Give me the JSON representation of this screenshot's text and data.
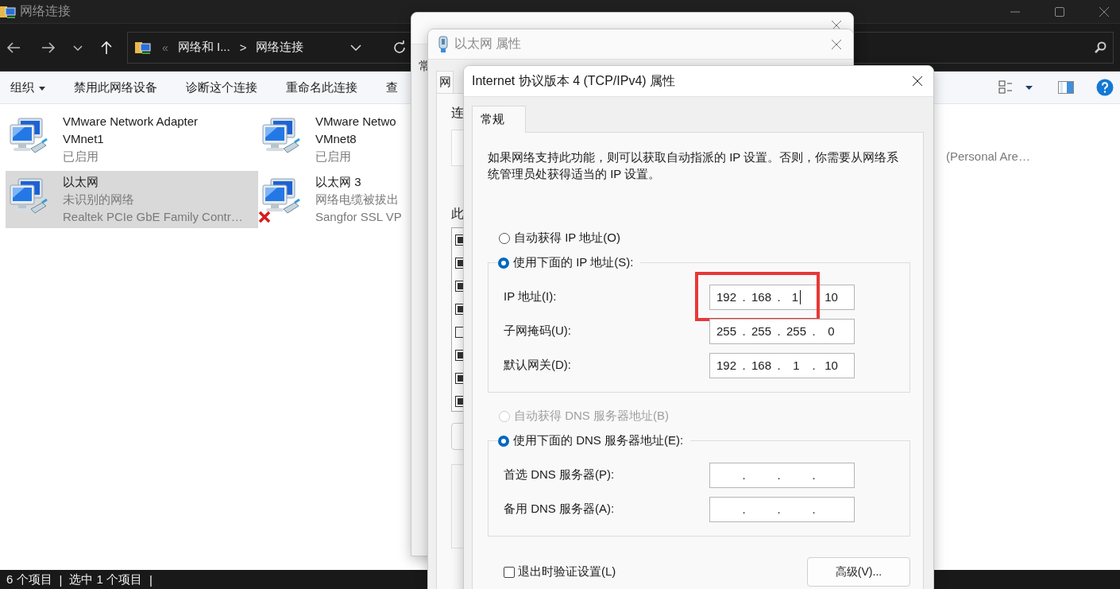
{
  "explorer": {
    "title": "网络连接",
    "breadcrumb": {
      "overflow_mark": "«",
      "parts": [
        "网络和 I...",
        "网络连接"
      ],
      "separator": ">"
    },
    "toolbar": [
      {
        "label": "组织",
        "dropdown": true
      },
      {
        "label": "禁用此网络设备",
        "dropdown": false
      },
      {
        "label": "诊断这个连接",
        "dropdown": false
      },
      {
        "label": "重命名此连接",
        "dropdown": false
      },
      {
        "label": "查",
        "dropdown": false
      }
    ],
    "items": [
      {
        "kind": "adapter",
        "title_lines": [
          "VMware Network Adapter",
          "VMnet1"
        ],
        "detail_lines": [
          "已启用"
        ],
        "selected": false,
        "disconnected": false
      },
      {
        "kind": "adapter",
        "title_lines": [
          "VMware Netwo",
          "VMnet8"
        ],
        "detail_lines": [
          "已启用"
        ],
        "selected": false,
        "disconnected": false
      },
      {
        "kind": "covered",
        "detail_lines": [
          "(Personal Are…"
        ],
        "selected": false
      },
      {
        "kind": "adapter",
        "title_lines": [
          "以太网"
        ],
        "detail_lines": [
          "未识别的网络",
          "Realtek PCIe GbE Family Contr…"
        ],
        "selected": true,
        "disconnected": false
      },
      {
        "kind": "adapter",
        "title_lines": [
          "以太网 3"
        ],
        "detail_lines": [
          "网络电缆被拔出",
          "Sangfor SSL VP"
        ],
        "selected": false,
        "disconnected": true
      }
    ],
    "status_bar": [
      "6 个项目",
      "|",
      "选中 1 个项目",
      "|"
    ]
  },
  "status_dialog": {
    "tab": "常"
  },
  "properties_dialog": {
    "title": "以太网 属性",
    "tab": "网",
    "labels": [
      "连",
      "此"
    ],
    "components": [
      {
        "checked": true
      },
      {
        "checked": true
      },
      {
        "checked": true
      },
      {
        "checked": true
      },
      {
        "checked": false
      },
      {
        "checked": true
      },
      {
        "checked": true
      },
      {
        "checked": true
      }
    ]
  },
  "ipv4_dialog": {
    "title": "Internet 协议版本 4 (TCP/IPv4) 属性",
    "tabs": [
      {
        "label": "常规",
        "selected": true
      }
    ],
    "description": "如果网络支持此功能，则可以获取自动指派的 IP 设置。否则，你需要从网络系统管理员处获得适当的 IP 设置。",
    "sections": [
      {
        "auto_option": {
          "label": "自动获得 IP 地址(O)",
          "selected": false,
          "disabled": false
        },
        "manual_option": {
          "label": "使用下面的 IP 地址(S):",
          "selected": true,
          "disabled": false
        },
        "fields": [
          {
            "label": "IP 地址(I):",
            "highlighted": true,
            "octets": [
              {
                "value": "192",
                "dot": ".",
                "caret": false
              },
              {
                "value": "168",
                "dot": ".",
                "caret": false
              },
              {
                "value": "1",
                "caret": true
              },
              {
                "value": "10",
                "caret": false
              }
            ]
          },
          {
            "label": "子网掩码(U):",
            "highlighted": false,
            "octets": [
              {
                "value": "255",
                "dot": ".",
                "caret": false
              },
              {
                "value": "255",
                "dot": ".",
                "caret": false
              },
              {
                "value": "255",
                "dot": ".",
                "caret": false
              },
              {
                "value": "0",
                "caret": false
              }
            ]
          },
          {
            "label": "默认网关(D):",
            "highlighted": false,
            "octets": [
              {
                "value": "192",
                "dot": ".",
                "caret": false
              },
              {
                "value": "168",
                "dot": ".",
                "caret": false
              },
              {
                "value": "1",
                "dot": ".",
                "caret": false
              },
              {
                "value": "10",
                "caret": false
              }
            ]
          }
        ]
      },
      {
        "auto_option": {
          "label": "自动获得 DNS 服务器地址(B)",
          "selected": false,
          "disabled": true
        },
        "manual_option": {
          "label": "使用下面的 DNS 服务器地址(E):",
          "selected": true,
          "disabled": false
        },
        "fields": [
          {
            "label": "首选 DNS 服务器(P):",
            "highlighted": false,
            "octets": [
              {
                "dot": ".",
                "caret": false
              },
              {
                "dot": ".",
                "caret": false
              },
              {
                "dot": ".",
                "caret": false
              }
            ]
          },
          {
            "label": "备用 DNS 服务器(A):",
            "highlighted": false,
            "octets": [
              {
                "dot": ".",
                "caret": false
              },
              {
                "dot": ".",
                "caret": false
              },
              {
                "dot": ".",
                "caret": false
              }
            ]
          }
        ]
      }
    ],
    "validate_on_exit": {
      "label": "退出时验证设置(L)",
      "checked": false
    },
    "advanced_button": "高级(V)..."
  }
}
